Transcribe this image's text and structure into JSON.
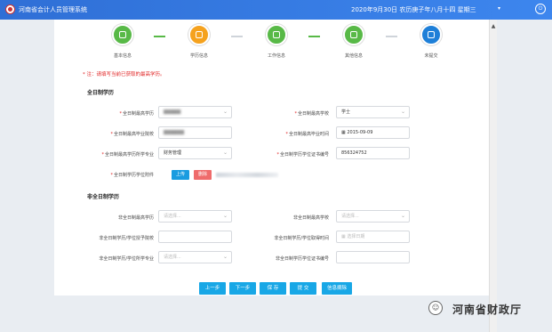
{
  "header": {
    "app_title": "河南省会计人员管理系统",
    "date_text": "2020年9月30日  农历庚子年八月十四  星期三",
    "user_name": "​"
  },
  "steps": [
    {
      "label": "基本信息",
      "color": "#58b947"
    },
    {
      "label": "学历信息",
      "color": "#f5a21e"
    },
    {
      "label": "工作信息",
      "color": "#58b947"
    },
    {
      "label": "其他信息",
      "color": "#58b947"
    },
    {
      "label": "未提交",
      "color": "#1e7fd8"
    }
  ],
  "note": "* 注：请填写当前已获取的最高学历。",
  "fulltime": {
    "section_title": "全日制学历",
    "highest_degree_label": "全日制最高学历",
    "highest_degree_value": "",
    "highest_school_label": "全日制最高学校",
    "highest_school_value": "学士",
    "graduation_school_label": "全日制最高毕业院校",
    "graduation_school_value": "",
    "graduation_time_label": "全日制最高毕业时间",
    "graduation_time_value": "2015-09-09",
    "major_label": "全日制最高学历所学专业",
    "major_value": "财务管理",
    "certificate_no_label": "全日制学历学位证书编号",
    "certificate_no_value": "856324752",
    "attachment_label": "全日制学历学位附件",
    "upload_label": "上传",
    "delete_label": "删除"
  },
  "nonfulltime": {
    "section_title": "非全日制学历",
    "highest_degree_label": "非全日制最高学历",
    "highest_degree_placeholder": "请选择...",
    "highest_school_label": "非全日制最高学校",
    "highest_school_placeholder": "请选择...",
    "graduation_school_label": "非全日制学历/学位授予院校",
    "graduation_time_label": "非全日制学历/学位取得时间",
    "graduation_time_placeholder": "选择日期",
    "major_label": "非全日制学历/学位所学专业",
    "major_placeholder": "请选择...",
    "certificate_no_label": "非全日制学历学位证书编号"
  },
  "actions": {
    "prev": "上一步",
    "next": "下一步",
    "save": "保 存",
    "submit": "提 交",
    "modify": "信息摘除"
  },
  "watermark": {
    "text": "河南省财政厅"
  }
}
